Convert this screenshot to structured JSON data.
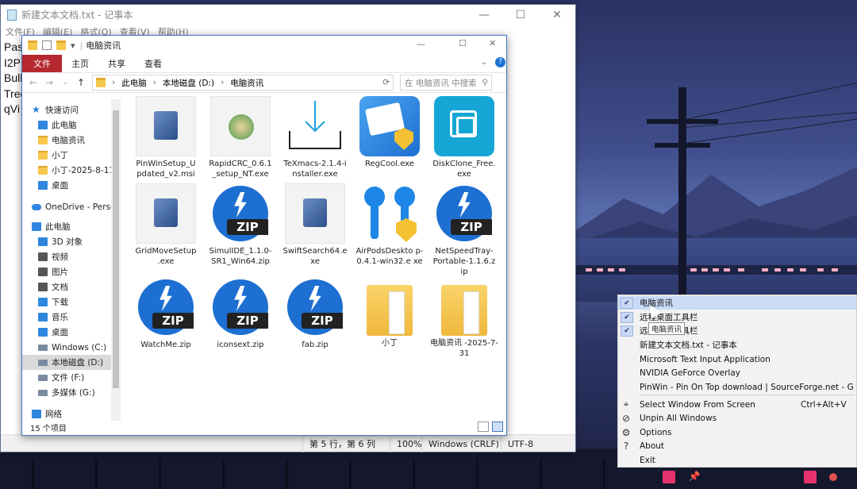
{
  "notepad": {
    "title": "新建文本文档.txt - 记事本",
    "menu": [
      "文件(F)",
      "编辑(E)",
      "格式(O)",
      "查看(V)",
      "帮助(H)"
    ],
    "lines": [
      "Pas",
      "I2P",
      "Bull",
      "Tree",
      "qVi"
    ],
    "status": {
      "position": "第 5 行，第 6 列",
      "zoom": "100%",
      "eol": "Windows (CRLF)",
      "encoding": "UTF-8"
    }
  },
  "explorer": {
    "title": "电脑资讯",
    "ribbon": [
      "文件",
      "主页",
      "共享",
      "查看"
    ],
    "path": [
      "此电脑",
      "本地磁盘 (D:)",
      "电脑资讯"
    ],
    "search_placeholder": "在 电脑资讯 中搜索",
    "nav": [
      {
        "label": "快速访问",
        "icon": "star-icon"
      },
      {
        "label": "此电脑",
        "icon": "pc-icon"
      },
      {
        "label": "电脑资讯",
        "icon": "folder-icon"
      },
      {
        "label": "小丁",
        "icon": "folder-icon"
      },
      {
        "label": "小丁-2025-8-11",
        "icon": "folder-icon"
      },
      {
        "label": "桌面",
        "icon": "desktop-icon"
      },
      {
        "label": "OneDrive - Perso",
        "icon": "onedrive-icon"
      },
      {
        "label": "此电脑",
        "icon": "pc-icon"
      },
      {
        "label": "3D 对象",
        "icon": "3d-icon"
      },
      {
        "label": "视频",
        "icon": "video-icon"
      },
      {
        "label": "图片",
        "icon": "pictures-icon"
      },
      {
        "label": "文档",
        "icon": "documents-icon"
      },
      {
        "label": "下载",
        "icon": "download-icon"
      },
      {
        "label": "音乐",
        "icon": "music-icon"
      },
      {
        "label": "桌面",
        "icon": "desktop-icon"
      },
      {
        "label": "Windows (C:)",
        "icon": "drive-icon"
      },
      {
        "label": "本地磁盘 (D:)",
        "icon": "drive-icon",
        "selected": true
      },
      {
        "label": "文件 (F:)",
        "icon": "drive-icon"
      },
      {
        "label": "多媒体 (G:)",
        "icon": "drive-icon"
      },
      {
        "label": "网络",
        "icon": "network-icon"
      }
    ],
    "files": [
      {
        "name": "PinWinSetup_U pdated_v2.msi",
        "type": "msi"
      },
      {
        "name": "RapidCRC_0.6.1 _setup_NT.exe",
        "type": "rapid"
      },
      {
        "name": "TeXmacs-2.1.4-i nstaller.exe",
        "type": "tex"
      },
      {
        "name": "RegCool.exe",
        "type": "regcool"
      },
      {
        "name": "DiskClone_Free. exe",
        "type": "diskclone"
      },
      {
        "name": "GridMoveSetup .exe",
        "type": "msi"
      },
      {
        "name": "SimulIDE_1.1.0- SR1_Win64.zip",
        "type": "zip"
      },
      {
        "name": "SwiftSearch64.e xe",
        "type": "search"
      },
      {
        "name": "AirPodsDeskto p-0.4.1-win32.e xe",
        "type": "airpods"
      },
      {
        "name": "NetSpeedTray- Portable-1.1.6.z ip",
        "type": "zip"
      },
      {
        "name": "WatchMe.zip",
        "type": "zip"
      },
      {
        "name": "iconsext.zip",
        "type": "zip"
      },
      {
        "name": "fab.zip",
        "type": "zip"
      },
      {
        "name": "小丁",
        "type": "folder"
      },
      {
        "name": "电脑资讯 -2025-7-31",
        "type": "folder"
      }
    ],
    "status": "15 个项目"
  },
  "zip_label": "ZIP",
  "context_menu": {
    "items": [
      {
        "label": "电脑资讯",
        "checked": true,
        "highlighted": true
      },
      {
        "label": "远程桌面工具栏",
        "checked": true
      },
      {
        "label": "远程桌面工具栏",
        "checked": true
      },
      {
        "label": "新建文本文档.txt - 记事本"
      },
      {
        "label": "Microsoft Text Input Application"
      },
      {
        "label": "NVIDIA GeForce Overlay"
      },
      {
        "label": "PinWin - Pin On Top download | SourceForge.net - G"
      },
      {
        "label": "Select Window From Screen",
        "shortcut": "Ctrl+Alt+V",
        "icon": "crosshair-icon"
      },
      {
        "label": "Unpin All Windows",
        "icon": "unpin-icon"
      },
      {
        "label": "Options",
        "icon": "options-icon"
      },
      {
        "label": "About",
        "icon": "help-icon"
      },
      {
        "label": "Exit"
      }
    ],
    "tooltip": "电脑资讯"
  }
}
